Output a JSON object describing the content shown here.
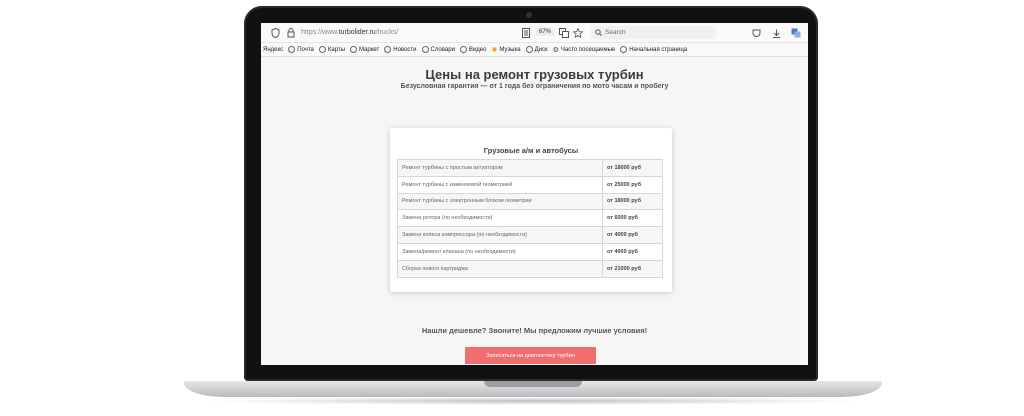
{
  "browser": {
    "url_prefix": "https://www.",
    "url_domain": "turbolider.ru",
    "url_path": "/trucks/",
    "zoom": "67%",
    "search_placeholder": "Search"
  },
  "bookmarks": [
    {
      "label": "Яндекс",
      "icon": "yandex-icon"
    },
    {
      "label": "Почта",
      "icon": "globe-icon"
    },
    {
      "label": "Карты",
      "icon": "globe-icon"
    },
    {
      "label": "Маркет",
      "icon": "globe-icon"
    },
    {
      "label": "Новости",
      "icon": "globe-icon"
    },
    {
      "label": "Словари",
      "icon": "globe-icon"
    },
    {
      "label": "Видео",
      "icon": "globe-icon"
    },
    {
      "label": "Музыка",
      "icon": "music-icon"
    },
    {
      "label": "Диск",
      "icon": "globe-icon"
    },
    {
      "label": "Часто посещаемые",
      "icon": "gear-icon"
    },
    {
      "label": "Начальная страница",
      "icon": "globe-icon"
    }
  ],
  "page": {
    "title": "Цены на ремонт грузовых турбин",
    "subtitle": "Безусловная гарантия — от 1 года без ограничения по мото часам и пробегу",
    "card_title": "Грузовые а/м и автобусы",
    "rows": [
      {
        "service": "Ремонт турбины с простым актуатором",
        "price": "от 18000 руб"
      },
      {
        "service": "Ремонт турбины с изменяемой геометрией",
        "price": "от 25000 руб"
      },
      {
        "service": "Ремонт турбины с электронным блоком геометрии",
        "price": "от 18000 руб"
      },
      {
        "service": "Замена ротора (по необходимости)",
        "price": "от 6000 руб"
      },
      {
        "service": "Замена колеса компрессора (по необходимости)",
        "price": "от 4000 руб"
      },
      {
        "service": "Замена/ремонт клапана (по необходимости)",
        "price": "от 4000 руб"
      },
      {
        "service": "Сборка нового картриджа",
        "price": "от 21000 руб"
      }
    ],
    "cta_text": "Нашли дешевле? Звоните! Мы предложим лучшие условия!",
    "cta_button": "Записаться на диагностику турбин"
  },
  "colors": {
    "accent": "#f06f6c"
  }
}
